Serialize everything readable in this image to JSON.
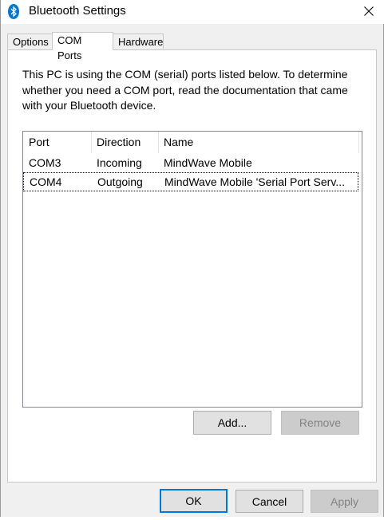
{
  "window": {
    "title": "Bluetooth Settings",
    "icon": "bluetooth-icon",
    "accent_color": "#0078d7"
  },
  "tabs": [
    {
      "label": "Options",
      "active": false
    },
    {
      "label": "COM Ports",
      "active": true
    },
    {
      "label": "Hardware",
      "active": false
    }
  ],
  "panel": {
    "description": "This PC is using the COM (serial) ports listed below. To determine whether you need a COM port, read the documentation that came with your Bluetooth device."
  },
  "ports_list": {
    "columns": [
      "Port",
      "Direction",
      "Name"
    ],
    "rows": [
      {
        "port": "COM3",
        "direction": "Incoming",
        "name": "MindWave Mobile"
      },
      {
        "port": "COM4",
        "direction": "Outgoing",
        "name": "MindWave Mobile 'Serial Port Serv..."
      }
    ]
  },
  "list_buttons": {
    "add_label": "Add...",
    "remove_label": "Remove"
  },
  "dialog_buttons": {
    "ok_label": "OK",
    "cancel_label": "Cancel",
    "apply_label": "Apply"
  }
}
